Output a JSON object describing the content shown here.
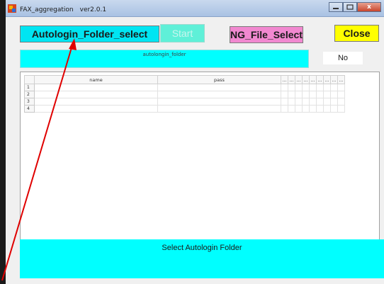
{
  "window": {
    "title": "FAX_aggregation　ver2.0.1",
    "controls": [
      "minimize-icon",
      "maximize-icon",
      "close-icon"
    ],
    "close_glyph": "x"
  },
  "toolbar": {
    "autologin_button": "Autologin_Folder_select",
    "start_button": "Start",
    "ng_button": "NG_File_Select",
    "close_button": "Close"
  },
  "folder": {
    "path_text": "autolongin_folder"
  },
  "flag": {
    "value": "No"
  },
  "table": {
    "columns": [
      "name",
      "pass",
      "...",
      "...",
      "...",
      "...",
      "...",
      "...",
      "...",
      "...",
      "..."
    ],
    "row_numbers": [
      "1",
      "2",
      "3",
      "4"
    ]
  },
  "status": {
    "message": "Select Autologin Folder"
  },
  "colors": {
    "cyan": "#00FFFF",
    "autologin_button": "#00E5F2",
    "ng_button": "#F188D0",
    "close_button": "#FFFF00",
    "annotation_arrow": "#E00000"
  }
}
